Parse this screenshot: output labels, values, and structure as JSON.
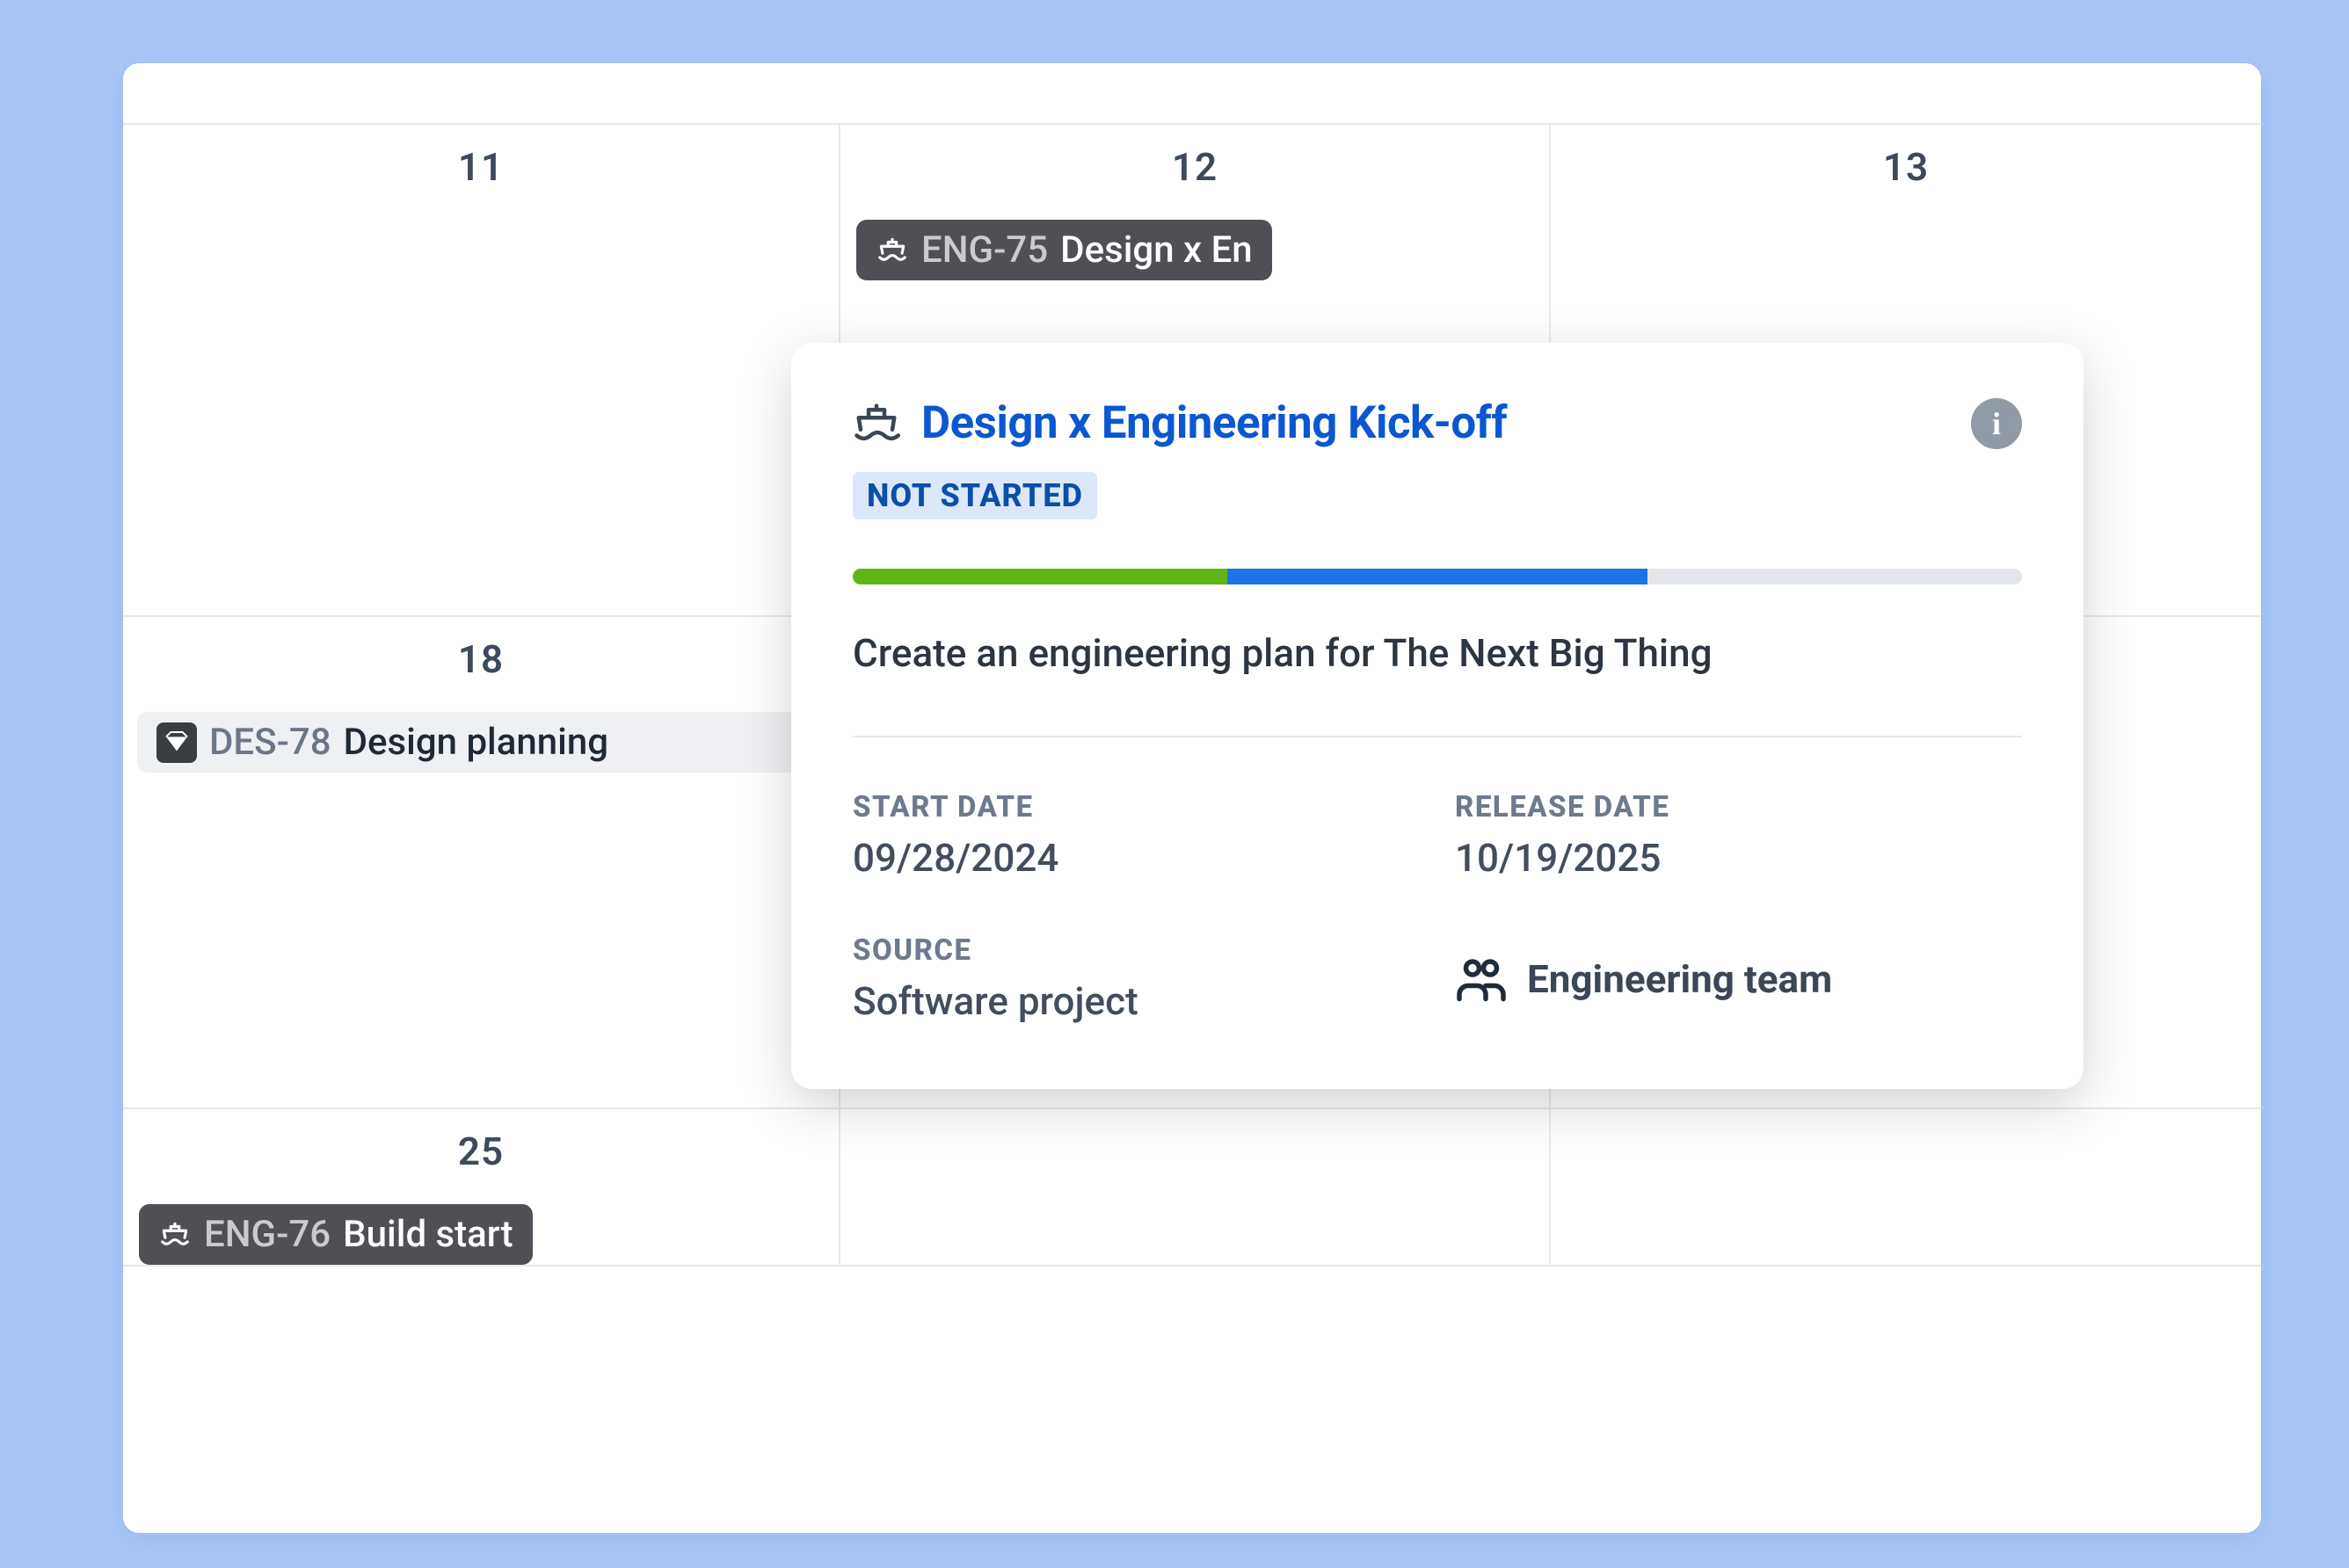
{
  "calendar": {
    "days": [
      "11",
      "12",
      "13",
      "18",
      "",
      "",
      "25",
      "",
      ""
    ]
  },
  "events": {
    "eng75": {
      "key": "ENG-75",
      "title": "Design x En"
    },
    "des78": {
      "key": "DES-78",
      "title": "Design planning"
    },
    "eng76": {
      "key": "ENG-76",
      "title": "Build start"
    }
  },
  "popover": {
    "title": "Design x Engineering Kick-off",
    "status": "NOT STARTED",
    "description": "Create an engineering plan for The Next Big Thing",
    "labels": {
      "start_date": "START DATE",
      "release_date": "RELEASE DATE",
      "source": "SOURCE"
    },
    "start_date": "09/28/2024",
    "release_date": "10/19/2025",
    "source": "Software project",
    "team": "Engineering team",
    "progress": {
      "green_pct": 32,
      "blue_pct": 36
    }
  }
}
